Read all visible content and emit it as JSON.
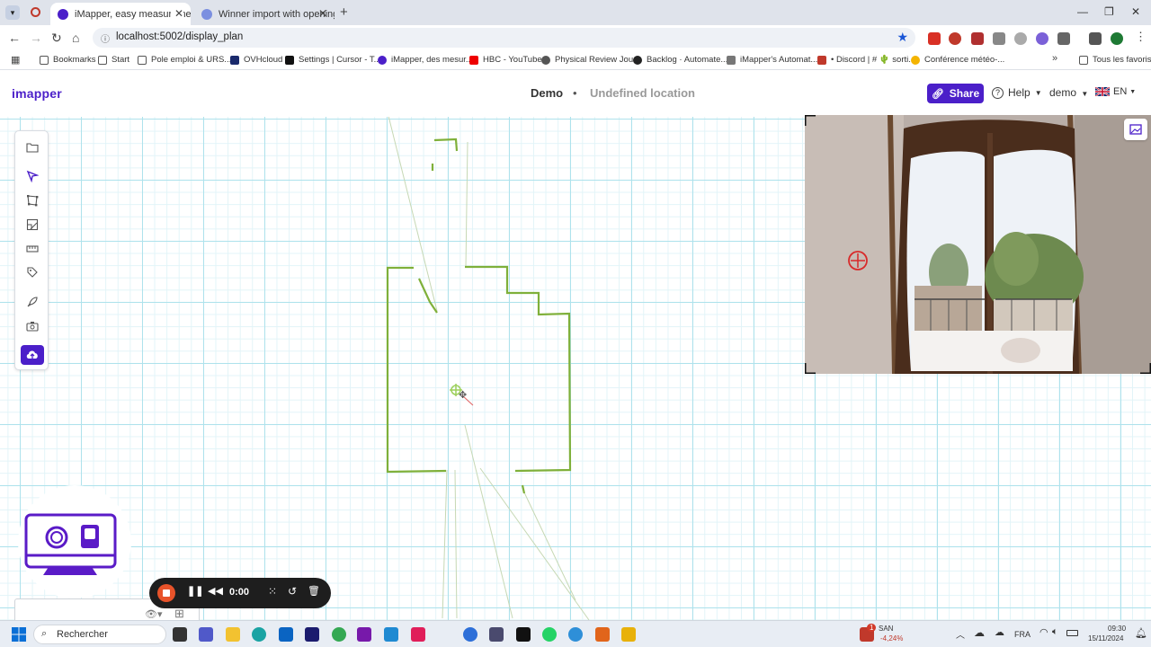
{
  "browser": {
    "tabs": [
      {
        "title": "iMapper, easy measureme",
        "active": true,
        "icon_color": "#4b1fc9"
      },
      {
        "title": "Winner import with openings",
        "active": false,
        "icon_color": "#6e7ee0"
      }
    ],
    "new_tab": "+",
    "window_controls": [
      "—",
      "❐",
      "✕"
    ],
    "url": "localhost:5002/display_plan",
    "bookmarks": [
      {
        "label": "Bookmarks",
        "icon": "star-icon",
        "color": "#555"
      },
      {
        "label": "Start",
        "icon": "folder-icon",
        "color": "#555"
      },
      {
        "label": "Pole emploi & URS...",
        "icon": "folder-icon",
        "color": "#555"
      },
      {
        "label": "OVHcloud",
        "icon": "ovh-icon",
        "color": "#1a2a6c"
      },
      {
        "label": "Settings | Cursor - T...",
        "icon": "cursor-icon",
        "color": "#111"
      },
      {
        "label": "iMapper, des mesur...",
        "icon": "imapper-icon",
        "color": "#4b1fc9"
      },
      {
        "label": "HBC - YouTube",
        "icon": "youtube-icon",
        "color": "#e00"
      },
      {
        "label": "Physical Review Jou...",
        "icon": "globe-icon",
        "color": "#555"
      },
      {
        "label": "Backlog · Automate...",
        "icon": "github-icon",
        "color": "#222"
      },
      {
        "label": "iMapper's Automat...",
        "icon": "board-icon",
        "color": "#777"
      },
      {
        "label": "• Discord | # 🌵 sorti...",
        "icon": "discord-icon",
        "color": "#c0392b"
      },
      {
        "label": "Conférence météo-...",
        "icon": "chrome-icon",
        "color": "#f4b400"
      }
    ],
    "all_bookmarks": "Tous les favoris"
  },
  "app": {
    "logo": "imapper",
    "project": "Demo",
    "separator": "•",
    "location": "Undefined location",
    "share_label": "Share",
    "help_label": "Help",
    "user_label": "demo",
    "lang_label": "EN",
    "accent_color": "#4b1fc9",
    "wall_color": "#7fb03a",
    "tools": [
      "folder-icon",
      "select-arrow-icon",
      "polygon-icon",
      "draw-room-icon",
      "ruler-icon",
      "tag-icon",
      "rocket-icon",
      "camera-icon",
      "cloud-upload-icon"
    ]
  },
  "recorder": {
    "time": "0:00"
  },
  "taskbar": {
    "search_placeholder": "Rechercher",
    "stock_name": "SAN",
    "stock_change": "-4,24%",
    "stock_badge": "1",
    "lang": "FRA",
    "time": "09:30",
    "date": "15/11/2024"
  }
}
